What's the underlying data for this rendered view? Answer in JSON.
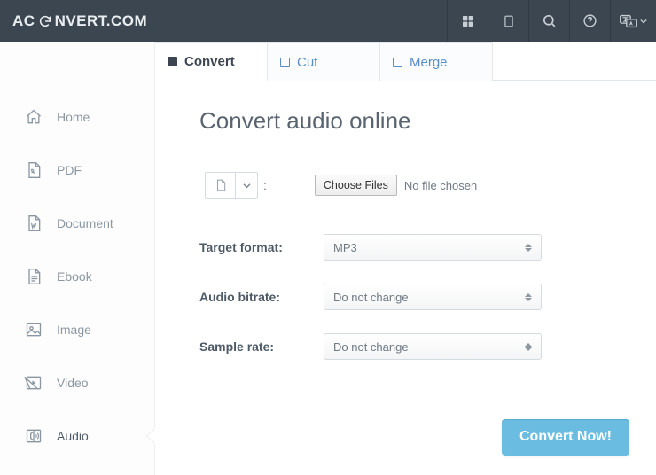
{
  "brand": {
    "part1": "AC",
    "part2": "NVERT.COM"
  },
  "sidebar": {
    "items": [
      {
        "label": "Home"
      },
      {
        "label": "PDF"
      },
      {
        "label": "Document"
      },
      {
        "label": "Ebook"
      },
      {
        "label": "Image"
      },
      {
        "label": "Video"
      },
      {
        "label": "Audio"
      }
    ],
    "active_index": 6
  },
  "tabs": [
    {
      "label": "Convert",
      "active": true
    },
    {
      "label": "Cut",
      "active": false
    },
    {
      "label": "Merge",
      "active": false
    }
  ],
  "page": {
    "title": "Convert audio online"
  },
  "file_picker": {
    "button_label": "Choose Files",
    "state_text": "No file chosen",
    "colon": ":"
  },
  "form": {
    "target_format": {
      "label": "Target format:",
      "value": "MP3"
    },
    "audio_bitrate": {
      "label": "Audio bitrate:",
      "value": "Do not change"
    },
    "sample_rate": {
      "label": "Sample rate:",
      "value": "Do not change"
    }
  },
  "cta": {
    "label": "Convert Now!"
  }
}
